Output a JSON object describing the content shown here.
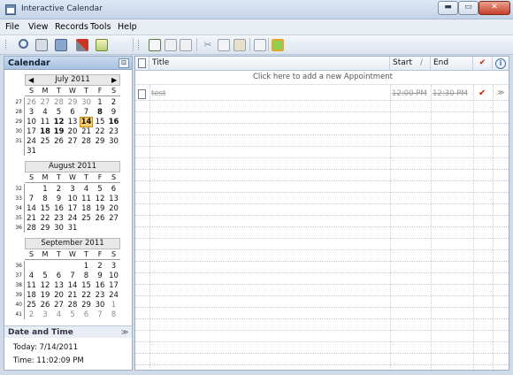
{
  "window": {
    "title": "Interactive Calendar",
    "min_symbol": "▬",
    "max_symbol": "▭",
    "close_symbol": "✕"
  },
  "menu": [
    "File",
    "View",
    "Records",
    "Tools",
    "Help"
  ],
  "toolbar_icons": [
    "grip-icon",
    "search-icon",
    "print-icon",
    "records-icon",
    "tools-icon",
    "export-icon",
    "grip-icon",
    "new-appointment-icon",
    "edit-icon",
    "edit-all-icon",
    "cut-icon",
    "copy-icon",
    "paste-icon",
    "properties-icon",
    "refresh-icon"
  ],
  "sidebar": {
    "header": "Calendar",
    "pin": "⊡",
    "date_time_header": "Date and Time",
    "date_time_chevron": "≫",
    "today_label": "Today: 7/14/2011",
    "time_label": "Time: 11:02:09 PM"
  },
  "weekdays": [
    "S",
    "M",
    "T",
    "W",
    "T",
    "F",
    "S"
  ],
  "months": [
    {
      "title": "July 2011",
      "has_nav": true,
      "weeks": [
        "27",
        "28",
        "29",
        "30",
        "31",
        ""
      ],
      "rows": [
        [
          [
            "26",
            "g"
          ],
          [
            "27",
            "g"
          ],
          [
            "28",
            "g"
          ],
          [
            "29",
            "g"
          ],
          [
            "30",
            "g"
          ],
          [
            "1",
            ""
          ],
          [
            "2",
            ""
          ]
        ],
        [
          [
            "3",
            ""
          ],
          [
            "4",
            ""
          ],
          [
            "5",
            ""
          ],
          [
            "6",
            ""
          ],
          [
            "7",
            ""
          ],
          [
            "8",
            "b"
          ],
          [
            "9",
            ""
          ]
        ],
        [
          [
            "10",
            ""
          ],
          [
            "11",
            ""
          ],
          [
            "12",
            "b"
          ],
          [
            "13",
            ""
          ],
          [
            "14",
            "t"
          ],
          [
            "15",
            ""
          ],
          [
            "16",
            "b"
          ]
        ],
        [
          [
            "17",
            ""
          ],
          [
            "18",
            "b"
          ],
          [
            "19",
            "b"
          ],
          [
            "20",
            ""
          ],
          [
            "21",
            ""
          ],
          [
            "22",
            ""
          ],
          [
            "23",
            ""
          ]
        ],
        [
          [
            "24",
            ""
          ],
          [
            "25",
            ""
          ],
          [
            "26",
            ""
          ],
          [
            "27",
            ""
          ],
          [
            "28",
            ""
          ],
          [
            "29",
            ""
          ],
          [
            "30",
            ""
          ]
        ],
        [
          [
            "31",
            ""
          ]
        ]
      ]
    },
    {
      "title": "August 2011",
      "has_nav": false,
      "weeks": [
        "32",
        "33",
        "34",
        "35",
        "36"
      ],
      "rows": [
        [
          [
            "",
            ""
          ],
          [
            "1",
            ""
          ],
          [
            "2",
            ""
          ],
          [
            "3",
            ""
          ],
          [
            "4",
            ""
          ],
          [
            "5",
            ""
          ],
          [
            "6",
            ""
          ]
        ],
        [
          [
            "7",
            ""
          ],
          [
            "8",
            ""
          ],
          [
            "9",
            ""
          ],
          [
            "10",
            ""
          ],
          [
            "11",
            ""
          ],
          [
            "12",
            ""
          ],
          [
            "13",
            ""
          ]
        ],
        [
          [
            "14",
            ""
          ],
          [
            "15",
            ""
          ],
          [
            "16",
            ""
          ],
          [
            "17",
            ""
          ],
          [
            "18",
            ""
          ],
          [
            "19",
            ""
          ],
          [
            "20",
            ""
          ]
        ],
        [
          [
            "21",
            ""
          ],
          [
            "22",
            ""
          ],
          [
            "23",
            ""
          ],
          [
            "24",
            ""
          ],
          [
            "25",
            ""
          ],
          [
            "26",
            ""
          ],
          [
            "27",
            ""
          ]
        ],
        [
          [
            "28",
            ""
          ],
          [
            "29",
            ""
          ],
          [
            "30",
            ""
          ],
          [
            "31",
            ""
          ]
        ]
      ]
    },
    {
      "title": "September 2011",
      "has_nav": false,
      "weeks": [
        "36",
        "37",
        "38",
        "39",
        "40",
        "41"
      ],
      "rows": [
        [
          [
            "",
            ""
          ],
          [
            "",
            ""
          ],
          [
            "",
            ""
          ],
          [
            "",
            ""
          ],
          [
            "1",
            ""
          ],
          [
            "2",
            ""
          ],
          [
            "3",
            ""
          ]
        ],
        [
          [
            "4",
            ""
          ],
          [
            "5",
            ""
          ],
          [
            "6",
            ""
          ],
          [
            "7",
            ""
          ],
          [
            "8",
            ""
          ],
          [
            "9",
            ""
          ],
          [
            "10",
            ""
          ]
        ],
        [
          [
            "11",
            ""
          ],
          [
            "12",
            ""
          ],
          [
            "13",
            ""
          ],
          [
            "14",
            ""
          ],
          [
            "15",
            ""
          ],
          [
            "16",
            ""
          ],
          [
            "17",
            ""
          ]
        ],
        [
          [
            "18",
            ""
          ],
          [
            "19",
            ""
          ],
          [
            "20",
            ""
          ],
          [
            "21",
            ""
          ],
          [
            "22",
            ""
          ],
          [
            "23",
            ""
          ],
          [
            "24",
            ""
          ]
        ],
        [
          [
            "25",
            ""
          ],
          [
            "26",
            ""
          ],
          [
            "27",
            ""
          ],
          [
            "28",
            ""
          ],
          [
            "29",
            ""
          ],
          [
            "30",
            ""
          ],
          [
            "1",
            "g"
          ]
        ],
        [
          [
            "2",
            "g"
          ],
          [
            "3",
            "g"
          ],
          [
            "4",
            "g"
          ],
          [
            "5",
            "g"
          ],
          [
            "6",
            "g"
          ],
          [
            "7",
            "g"
          ],
          [
            "8",
            "g"
          ]
        ]
      ]
    }
  ],
  "grid": {
    "columns": {
      "title": "Title",
      "start": "Start",
      "sort": "/",
      "end": "End",
      "check": "✔",
      "info": "i"
    },
    "add_prompt": "Click here to add a new Appointment",
    "appointments": [
      {
        "title": "test",
        "start": "12:00 PM",
        "end": "12:30 PM",
        "check": "✔",
        "expand": "≫"
      }
    ]
  },
  "colors": {
    "accent": "#dfe9f5",
    "header": "#c7d9ef",
    "check": "#cc2200",
    "today": "#ffcf6a"
  }
}
